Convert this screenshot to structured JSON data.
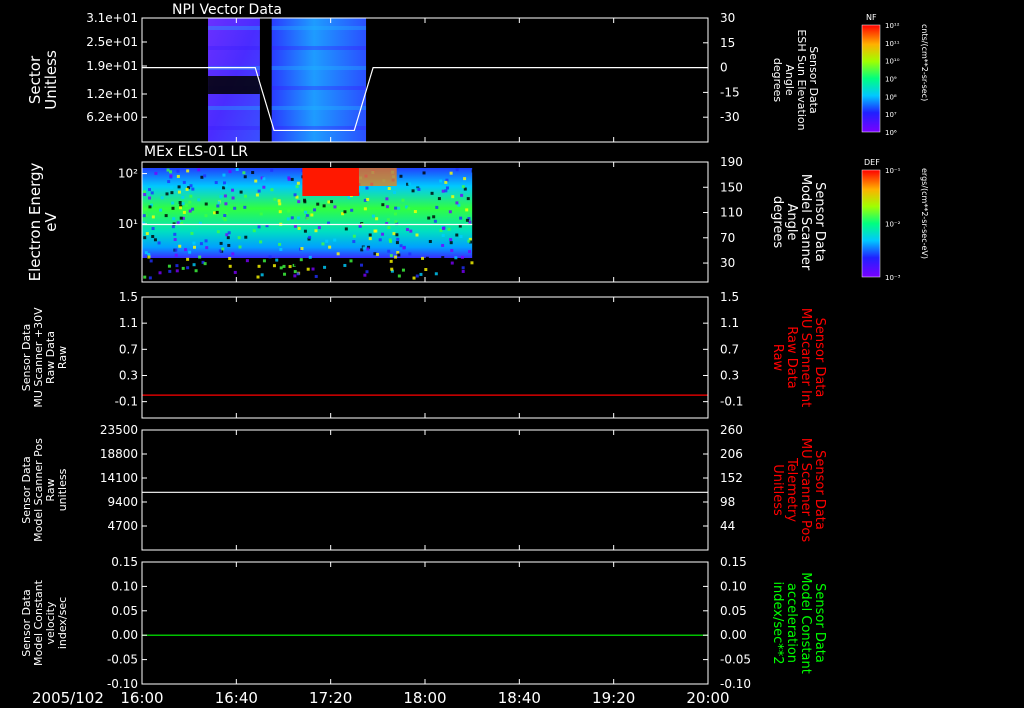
{
  "time_axis": {
    "date": "2005/102",
    "ticks": [
      "16:00",
      "16:40",
      "17:20",
      "18:00",
      "18:40",
      "19:20",
      "20:00"
    ],
    "range_min": [
      960,
      1200
    ],
    "tick_min": [
      960,
      1000,
      1040,
      1080,
      1120,
      1160,
      1200
    ]
  },
  "colorbars": [
    {
      "name": "NF",
      "unit": "cnts/(cm**2-sr-sec)",
      "ticks": [
        "10¹²",
        "10¹¹",
        "10¹⁰",
        "10⁹",
        "10⁸",
        "10⁷",
        "10⁶"
      ]
    },
    {
      "name": "DEF",
      "unit": "ergs/(cm**2-sr-sec-eV)",
      "ticks": [
        "10⁻¹",
        "10⁻²",
        "10⁻³"
      ]
    }
  ],
  "colors": {
    "red": "#ff0000",
    "green": "#00ff00",
    "white": "#ffffff"
  },
  "chart_data": [
    {
      "type": "heatmap",
      "title": "NPI Vector Data",
      "ylabel": [
        "Sector",
        "Unitless"
      ],
      "yticks": [
        "3.1e+01",
        "2.5e+01",
        "1.9e+01",
        "1.2e+01",
        "6.2e+00"
      ],
      "ylim": [
        0,
        31
      ],
      "right_ylabel": [
        "Sensor Data",
        "ESH Sun Elevation",
        "Angle",
        "degrees"
      ],
      "right_yticks": [
        "30",
        "15",
        "0",
        "-15",
        "-30"
      ],
      "right_ylim": [
        -45,
        30
      ],
      "heatmap_blocks": [
        {
          "t0": 988,
          "t1": 1010,
          "s0": 0,
          "s1": 31
        },
        {
          "t0": 1015,
          "t1": 1055,
          "s0": 0,
          "s1": 31
        }
      ],
      "series": [
        {
          "color": "#ffffff",
          "x_min": [
            960,
            1008,
            1016,
            1033,
            1050,
            1058,
            1200
          ],
          "y": [
            0,
            0,
            -38,
            -38,
            -38,
            0,
            0
          ]
        }
      ]
    },
    {
      "type": "heatmap",
      "title": "MEx ELS-01 LR",
      "ylabel": [
        "Electron Energy",
        "eV"
      ],
      "yticks": [
        "10²",
        "10¹"
      ],
      "ylog": true,
      "ylim": [
        0.7,
        170
      ],
      "right_ylabel": [
        "Sensor Data",
        "Model Scanner",
        "Angle",
        "degrees"
      ],
      "right_yticks": [
        "190",
        "150",
        "110",
        "70",
        "30"
      ],
      "right_ylim": [
        0,
        190
      ],
      "heatmap_span_min": [
        960,
        1100
      ],
      "series": [
        {
          "color": "#ffffff",
          "x_min": [
            960,
            1100
          ],
          "y": [
            91,
            91
          ]
        }
      ]
    },
    {
      "type": "line",
      "ylabel": [
        "Sensor Data",
        "MU Scanner +30V",
        "Raw Data",
        "Raw"
      ],
      "yticks": [
        "1.5",
        "1.1",
        "0.7",
        "0.3",
        "-0.1"
      ],
      "ylim": [
        -0.35,
        1.5
      ],
      "right_ylabel": [
        "Sensor Data",
        "MU Scanner Int",
        "Raw Data",
        "Raw"
      ],
      "right_yticks": [
        "1.5",
        "1.1",
        "0.7",
        "0.3",
        "-0.1"
      ],
      "right_ylim": [
        -0.35,
        1.5
      ],
      "series": [
        {
          "color": "#ff0000",
          "x_min": [
            960,
            1200
          ],
          "y": [
            0,
            0
          ]
        }
      ]
    },
    {
      "type": "line",
      "ylabel": [
        "Sensor Data",
        "Model Scanner Pos",
        "Raw",
        "unitless"
      ],
      "yticks": [
        "23500",
        "18800",
        "14100",
        "9400",
        "4700"
      ],
      "ylim": [
        0,
        23500
      ],
      "right_ylabel": [
        "Sensor Data",
        "MU Scanner Pos",
        "Telemetry",
        "Unitless"
      ],
      "right_yticks": [
        "260",
        "206",
        "152",
        "98",
        "44"
      ],
      "right_ylim": [
        -10,
        260
      ],
      "series": [
        {
          "color": "#ffffff",
          "x_min": [
            960,
            1200
          ],
          "y": [
            11300,
            11300
          ]
        },
        {
          "color": "#ff0000",
          "x_min": [
            960,
            1200
          ],
          "y": [
            8400,
            8400
          ]
        }
      ]
    },
    {
      "type": "line",
      "ylabel": [
        "Sensor Data",
        "Model Constant",
        "velocity",
        "index/sec"
      ],
      "yticks": [
        "0.15",
        "0.10",
        "0.05",
        "0.00",
        "-0.05",
        "-0.10"
      ],
      "ylim": [
        -0.1,
        0.15
      ],
      "right_ylabel": [
        "Sensor Data",
        "Model Constant",
        "acceleration",
        "index/sec**2"
      ],
      "right_yticks": [
        "0.15",
        "0.10",
        "0.05",
        "0.00",
        "-0.05",
        "-0.10"
      ],
      "right_ylim": [
        -0.1,
        0.15
      ],
      "series": [
        {
          "color": "#00ff00",
          "x_min": [
            960,
            1200
          ],
          "y": [
            0,
            0
          ]
        }
      ]
    }
  ]
}
